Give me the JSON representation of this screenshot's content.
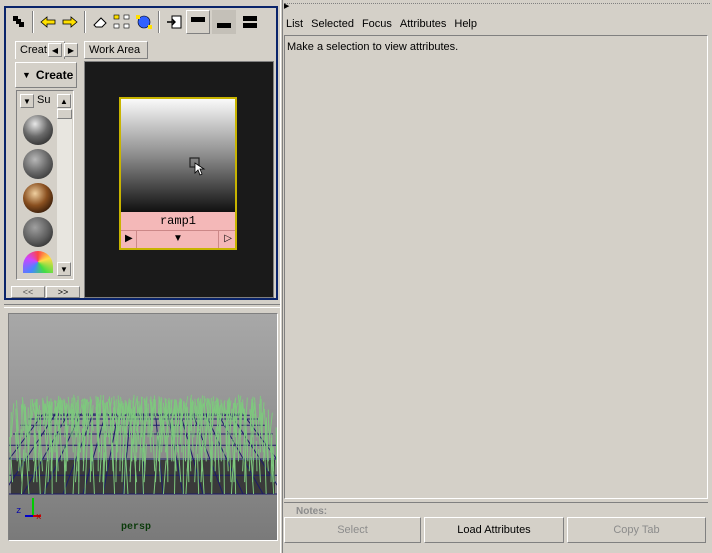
{
  "hypershade": {
    "tabs": {
      "create": "Creat",
      "work_area": "Work Area"
    },
    "create_bar_label": "Create",
    "list_header": "Su",
    "node_name": "ramp1",
    "nav": {
      "prev": "<<",
      "next": ">>"
    }
  },
  "viewport": {
    "camera_label": "persp",
    "axis_x": "x",
    "axis_z": "z"
  },
  "attribute_editor": {
    "menu": [
      "List",
      "Selected",
      "Focus",
      "Attributes",
      "Help"
    ],
    "message": "Make a selection to view attributes.",
    "notes_label": "Notes:",
    "buttons": {
      "select": "Select",
      "load": "Load Attributes",
      "copy_tab": "Copy Tab"
    }
  },
  "colors": {
    "accent_border": "#0a246a",
    "swatch_label_bg": "#f4b8b8",
    "selection_yellow": "#c8b400",
    "grass": "#7ec87e"
  }
}
